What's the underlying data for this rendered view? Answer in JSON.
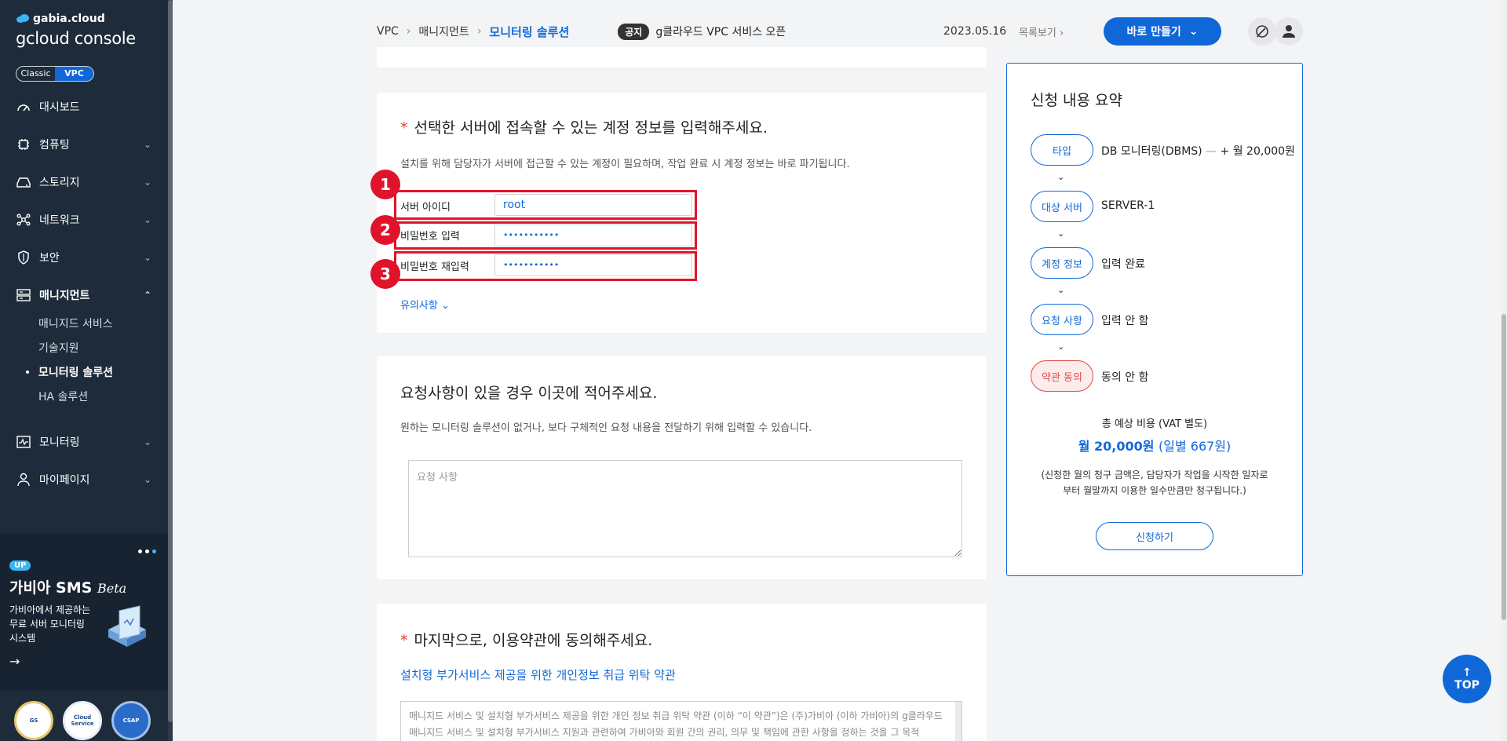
{
  "sidebar": {
    "brand_top": "gabia.cloud",
    "brand_main": "gcloud console",
    "toggle": {
      "classic": "Classic",
      "vpc": "VPC"
    },
    "nav": {
      "dashboard": "대시보드",
      "computing": "컴퓨팅",
      "storage": "스토리지",
      "network": "네트워크",
      "security": "보안",
      "management": "매니지먼트",
      "monitoring": "모니터링",
      "mypage": "마이페이지"
    },
    "sub": {
      "managed": "매니지드 서비스",
      "techsupport": "기술지원",
      "monitoring_solution": "모니터링 솔루션",
      "ha": "HA 솔루션"
    },
    "banner": {
      "up": "UP",
      "title": "가비아 SMS",
      "beta": "Beta",
      "desc": "가비아에서 제공하는 무료 서버 모니터링 시스템",
      "arrow": "→"
    }
  },
  "header": {
    "crumbs": [
      "VPC",
      "매니지먼트",
      "모니터링 솔루션"
    ],
    "sep": "›",
    "notice_badge": "공지",
    "notice_text": "g클라우드 VPC 서비스 오픈",
    "date": "2023.05.16",
    "list_link": "목록보기 ›",
    "make_button": "바로 만들기",
    "make_chev": "⌄"
  },
  "account": {
    "required": "*",
    "title": "선택한 서버에 접속할 수 있는 계정 정보를 입력해주세요.",
    "desc": "설치를 위해 담당자가 서버에 접근할 수 있는 계정이 필요하며, 작업 완료 시 계정 정보는 바로 파기됩니다.",
    "id_label": "서버 아이디",
    "id_value": "root",
    "pw_label": "비밀번호 입력",
    "pw_value": "•••••••••••",
    "pw2_label": "비밀번호 재입력",
    "pw2_value": "•••••••••••",
    "caution": "유의사항 ⌄",
    "markers": [
      "1",
      "2",
      "3"
    ]
  },
  "request": {
    "title": "요청사항이 있을 경우 이곳에 적어주세요.",
    "desc": "원하는 모니터링 솔루션이 없거나, 보다 구체적인 요청 내용을 전달하기 위해 입력할 수 있습니다.",
    "placeholder": "요청 사항"
  },
  "terms": {
    "required": "*",
    "title": "마지막으로, 이용약관에 동의해주세요.",
    "link": "설치형 부가서비스 제공을 위한 개인정보 취급 위탁 약관",
    "body": "매니지드 서비스 및 설치형 부가서비스 제공을 위한 개인 정보 취급 위탁 약관 (이하 “이 약관”)은 (주)가비아 (이하 가비아)의 g클라우드 매니지드 서비스 및 설치형 부가서비스 지원과 관련하여 가비아와 회원 간의 권리, 의무 및 책임에 관한 사항을 정하는 것을 그 목적"
  },
  "summary": {
    "title": "신청 내용 요약",
    "steps": [
      {
        "label": "타입",
        "value": "DB 모니터링(DBMS)",
        "dash": " — ",
        "extra": "+ 월 20,000원"
      },
      {
        "label": "대상 서버",
        "value": "SERVER-1"
      },
      {
        "label": "계정 정보",
        "value": "입력 완료"
      },
      {
        "label": "요청 사항",
        "value": "입력 안 함"
      },
      {
        "label": "약관 동의",
        "value": "동의 안 함"
      }
    ],
    "arrow": "⌄",
    "cost_label": "총 예상 비용 (VAT 별도)",
    "cost_value": "월 20,000원",
    "cost_daily": "(일별 667원)",
    "note": "(신청한 월의 청구 금액은, 담당자가 작업을 시작한 일자로부터 월말까지 이용한 일수만큼만 청구됩니다.)",
    "apply_button": "신청하기"
  },
  "top_button": {
    "arrow": "↑",
    "label": "TOP"
  },
  "badges": [
    "GS",
    "Cloud Service",
    "CSAP"
  ],
  "colors": {
    "accent": "#1068d8",
    "sidebar": "#1d2b3a",
    "marker": "#e0132a"
  }
}
